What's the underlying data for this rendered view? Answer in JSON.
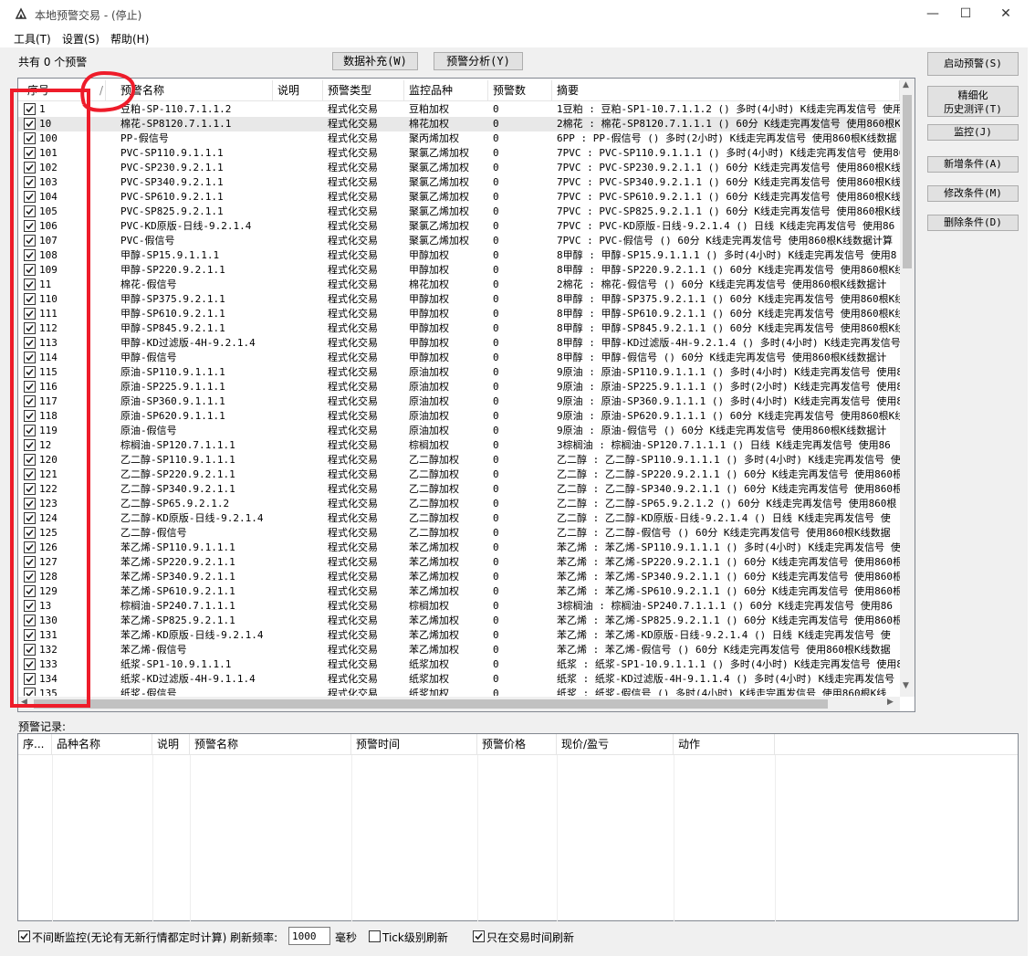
{
  "window": {
    "title": "本地预警交易 - (停止)",
    "minimize": "—",
    "maximize": "☐",
    "close": "✕"
  },
  "menu": [
    {
      "label": "工具(T)"
    },
    {
      "label": "设置(S)"
    },
    {
      "label": "帮助(H)"
    }
  ],
  "summary": {
    "count_label": "共有 0 个预警"
  },
  "toolbar": {
    "data_fill_label": "数据补充(W)",
    "analysis_label": "预警分析(Y)"
  },
  "side_buttons": {
    "start_label": "启动预警(S)",
    "refine_line1": "精细化",
    "refine_line2": "历史测评(T)",
    "monitor_label": "监控(J)",
    "add_label": "新增条件(A)",
    "edit_label": "修改条件(M)",
    "delete_label": "删除条件(D)"
  },
  "grid": {
    "columns": [
      "序号",
      "/",
      "预警名称",
      "说明",
      "预警类型",
      "监控品种",
      "预警数",
      "摘要"
    ],
    "rows": [
      {
        "id": "1",
        "name": "豆粕-SP-110.7.1.1.2",
        "note": "",
        "type": "程式化交易",
        "variety": "豆粕加权",
        "count": "0",
        "summary": "1豆粕 : 豆粕-SP1-10.7.1.1.2 () 多时(4小时) K线走完再发信号 使用",
        "checked": true
      },
      {
        "id": "10",
        "name": "棉花-SP8120.7.1.1.1",
        "note": "",
        "type": "程式化交易",
        "variety": "棉花加权",
        "count": "0",
        "summary": "2棉花 : 棉花-SP8120.7.1.1.1 () 60分 K线走完再发信号 使用860根K线",
        "checked": true
      },
      {
        "id": "100",
        "name": "PP-假信号",
        "note": "",
        "type": "程式化交易",
        "variety": "聚丙烯加权",
        "count": "0",
        "summary": "6PP : PP-假信号 () 多时(2小时) K线走完再发信号 使用860根K线数据",
        "checked": true
      },
      {
        "id": "101",
        "name": "PVC-SP110.9.1.1.1",
        "note": "",
        "type": "程式化交易",
        "variety": "聚氯乙烯加权",
        "count": "0",
        "summary": "7PVC : PVC-SP110.9.1.1.1 () 多时(4小时) K线走完再发信号 使用86",
        "checked": true
      },
      {
        "id": "102",
        "name": "PVC-SP230.9.2.1.1",
        "note": "",
        "type": "程式化交易",
        "variety": "聚氯乙烯加权",
        "count": "0",
        "summary": "7PVC : PVC-SP230.9.2.1.1 () 60分 K线走完再发信号 使用860根K线数",
        "checked": true
      },
      {
        "id": "103",
        "name": "PVC-SP340.9.2.1.1",
        "note": "",
        "type": "程式化交易",
        "variety": "聚氯乙烯加权",
        "count": "0",
        "summary": "7PVC : PVC-SP340.9.2.1.1 () 60分 K线走完再发信号 使用860根K线数",
        "checked": true
      },
      {
        "id": "104",
        "name": "PVC-SP610.9.2.1.1",
        "note": "",
        "type": "程式化交易",
        "variety": "聚氯乙烯加权",
        "count": "0",
        "summary": "7PVC : PVC-SP610.9.2.1.1 () 60分 K线走完再发信号 使用860根K线数",
        "checked": true
      },
      {
        "id": "105",
        "name": "PVC-SP825.9.2.1.1",
        "note": "",
        "type": "程式化交易",
        "variety": "聚氯乙烯加权",
        "count": "0",
        "summary": "7PVC : PVC-SP825.9.2.1.1 () 60分 K线走完再发信号 使用860根K线数",
        "checked": true
      },
      {
        "id": "106",
        "name": "PVC-KD原版-日线-9.2.1.4",
        "note": "",
        "type": "程式化交易",
        "variety": "聚氯乙烯加权",
        "count": "0",
        "summary": "7PVC : PVC-KD原版-日线-9.2.1.4 () 日线 K线走完再发信号 使用86",
        "checked": true
      },
      {
        "id": "107",
        "name": "PVC-假信号",
        "note": "",
        "type": "程式化交易",
        "variety": "聚氯乙烯加权",
        "count": "0",
        "summary": "7PVC : PVC-假信号 () 60分 K线走完再发信号 使用860根K线数据计算",
        "checked": true
      },
      {
        "id": "108",
        "name": "甲醇-SP15.9.1.1.1",
        "note": "",
        "type": "程式化交易",
        "variety": "甲醇加权",
        "count": "0",
        "summary": "8甲醇 : 甲醇-SP15.9.1.1.1 () 多时(4小时) K线走完再发信号 使用8",
        "checked": true
      },
      {
        "id": "109",
        "name": "甲醇-SP220.9.2.1.1",
        "note": "",
        "type": "程式化交易",
        "variety": "甲醇加权",
        "count": "0",
        "summary": "8甲醇 : 甲醇-SP220.9.2.1.1 () 60分 K线走完再发信号 使用860根K线",
        "checked": true
      },
      {
        "id": "11",
        "name": "棉花-假信号",
        "note": "",
        "type": "程式化交易",
        "variety": "棉花加权",
        "count": "0",
        "summary": "2棉花 : 棉花-假信号 () 60分 K线走完再发信号 使用860根K线数据计",
        "checked": true
      },
      {
        "id": "110",
        "name": "甲醇-SP375.9.2.1.1",
        "note": "",
        "type": "程式化交易",
        "variety": "甲醇加权",
        "count": "0",
        "summary": "8甲醇 : 甲醇-SP375.9.2.1.1 () 60分 K线走完再发信号 使用860根K线",
        "checked": true
      },
      {
        "id": "111",
        "name": "甲醇-SP610.9.2.1.1",
        "note": "",
        "type": "程式化交易",
        "variety": "甲醇加权",
        "count": "0",
        "summary": "8甲醇 : 甲醇-SP610.9.2.1.1 () 60分 K线走完再发信号 使用860根K线",
        "checked": true
      },
      {
        "id": "112",
        "name": "甲醇-SP845.9.2.1.1",
        "note": "",
        "type": "程式化交易",
        "variety": "甲醇加权",
        "count": "0",
        "summary": "8甲醇 : 甲醇-SP845.9.2.1.1 () 60分 K线走完再发信号 使用860根K线",
        "checked": true
      },
      {
        "id": "113",
        "name": "甲醇-KD过滤版-4H-9.2.1.4",
        "note": "",
        "type": "程式化交易",
        "variety": "甲醇加权",
        "count": "0",
        "summary": "8甲醇 : 甲醇-KD过滤版-4H-9.2.1.4 () 多时(4小时) K线走完再发信号",
        "checked": true
      },
      {
        "id": "114",
        "name": "甲醇-假信号",
        "note": "",
        "type": "程式化交易",
        "variety": "甲醇加权",
        "count": "0",
        "summary": "8甲醇 : 甲醇-假信号 () 60分 K线走完再发信号 使用860根K线数据计",
        "checked": true
      },
      {
        "id": "115",
        "name": "原油-SP110.9.1.1.1",
        "note": "",
        "type": "程式化交易",
        "variety": "原油加权",
        "count": "0",
        "summary": "9原油 : 原油-SP110.9.1.1.1 () 多时(4小时) K线走完再发信号 使用8",
        "checked": true
      },
      {
        "id": "116",
        "name": "原油-SP225.9.1.1.1",
        "note": "",
        "type": "程式化交易",
        "variety": "原油加权",
        "count": "0",
        "summary": "9原油 : 原油-SP225.9.1.1.1 () 多时(2小时) K线走完再发信号 使用8",
        "checked": true
      },
      {
        "id": "117",
        "name": "原油-SP360.9.1.1.1",
        "note": "",
        "type": "程式化交易",
        "variety": "原油加权",
        "count": "0",
        "summary": "9原油 : 原油-SP360.9.1.1.1 () 多时(4小时) K线走完再发信号 使用8",
        "checked": true
      },
      {
        "id": "118",
        "name": "原油-SP620.9.1.1.1",
        "note": "",
        "type": "程式化交易",
        "variety": "原油加权",
        "count": "0",
        "summary": "9原油 : 原油-SP620.9.1.1.1 () 60分 K线走完再发信号 使用860根K线",
        "checked": true
      },
      {
        "id": "119",
        "name": "原油-假信号",
        "note": "",
        "type": "程式化交易",
        "variety": "原油加权",
        "count": "0",
        "summary": "9原油 : 原油-假信号 () 60分 K线走完再发信号 使用860根K线数据计",
        "checked": true
      },
      {
        "id": "12",
        "name": "棕榈油-SP120.7.1.1.1",
        "note": "",
        "type": "程式化交易",
        "variety": "棕榈加权",
        "count": "0",
        "summary": "3棕榈油 : 棕榈油-SP120.7.1.1.1 () 日线 K线走完再发信号 使用86",
        "checked": true
      },
      {
        "id": "120",
        "name": "乙二醇-SP110.9.1.1.1",
        "note": "",
        "type": "程式化交易",
        "variety": "乙二醇加权",
        "count": "0",
        "summary": "乙二醇 : 乙二醇-SP110.9.1.1.1 () 多时(4小时) K线走完再发信号 使",
        "checked": true
      },
      {
        "id": "121",
        "name": "乙二醇-SP220.9.2.1.1",
        "note": "",
        "type": "程式化交易",
        "variety": "乙二醇加权",
        "count": "0",
        "summary": "乙二醇 : 乙二醇-SP220.9.2.1.1 () 60分 K线走完再发信号 使用860根",
        "checked": true
      },
      {
        "id": "122",
        "name": "乙二醇-SP340.9.2.1.1",
        "note": "",
        "type": "程式化交易",
        "variety": "乙二醇加权",
        "count": "0",
        "summary": "乙二醇 : 乙二醇-SP340.9.2.1.1 () 60分 K线走完再发信号 使用860根",
        "checked": true
      },
      {
        "id": "123",
        "name": "乙二醇-SP65.9.2.1.2",
        "note": "",
        "type": "程式化交易",
        "variety": "乙二醇加权",
        "count": "0",
        "summary": "乙二醇 : 乙二醇-SP65.9.2.1.2 () 60分 K线走完再发信号 使用860根",
        "checked": true
      },
      {
        "id": "124",
        "name": "乙二醇-KD原版-日线-9.2.1.4",
        "note": "",
        "type": "程式化交易",
        "variety": "乙二醇加权",
        "count": "0",
        "summary": "乙二醇 : 乙二醇-KD原版-日线-9.2.1.4 () 日线 K线走完再发信号 使",
        "checked": true
      },
      {
        "id": "125",
        "name": "乙二醇-假信号",
        "note": "",
        "type": "程式化交易",
        "variety": "乙二醇加权",
        "count": "0",
        "summary": "乙二醇 : 乙二醇-假信号 () 60分 K线走完再发信号 使用860根K线数据",
        "checked": true
      },
      {
        "id": "126",
        "name": "苯乙烯-SP110.9.1.1.1",
        "note": "",
        "type": "程式化交易",
        "variety": "苯乙烯加权",
        "count": "0",
        "summary": "苯乙烯 : 苯乙烯-SP110.9.1.1.1 () 多时(4小时) K线走完再发信号 使",
        "checked": true
      },
      {
        "id": "127",
        "name": "苯乙烯-SP220.9.2.1.1",
        "note": "",
        "type": "程式化交易",
        "variety": "苯乙烯加权",
        "count": "0",
        "summary": "苯乙烯 : 苯乙烯-SP220.9.2.1.1 () 60分 K线走完再发信号 使用860根",
        "checked": true
      },
      {
        "id": "128",
        "name": "苯乙烯-SP340.9.2.1.1",
        "note": "",
        "type": "程式化交易",
        "variety": "苯乙烯加权",
        "count": "0",
        "summary": "苯乙烯 : 苯乙烯-SP340.9.2.1.1 () 60分 K线走完再发信号 使用860根",
        "checked": true
      },
      {
        "id": "129",
        "name": "苯乙烯-SP610.9.2.1.1",
        "note": "",
        "type": "程式化交易",
        "variety": "苯乙烯加权",
        "count": "0",
        "summary": "苯乙烯 : 苯乙烯-SP610.9.2.1.1 () 60分 K线走完再发信号 使用860根",
        "checked": true
      },
      {
        "id": "13",
        "name": "棕榈油-SP240.7.1.1.1",
        "note": "",
        "type": "程式化交易",
        "variety": "棕榈加权",
        "count": "0",
        "summary": "3棕榈油 : 棕榈油-SP240.7.1.1.1 () 60分 K线走完再发信号 使用86",
        "checked": true
      },
      {
        "id": "130",
        "name": "苯乙烯-SP825.9.2.1.1",
        "note": "",
        "type": "程式化交易",
        "variety": "苯乙烯加权",
        "count": "0",
        "summary": "苯乙烯 : 苯乙烯-SP825.9.2.1.1 () 60分 K线走完再发信号 使用860根",
        "checked": true
      },
      {
        "id": "131",
        "name": "苯乙烯-KD原版-日线-9.2.1.4",
        "note": "",
        "type": "程式化交易",
        "variety": "苯乙烯加权",
        "count": "0",
        "summary": "苯乙烯 : 苯乙烯-KD原版-日线-9.2.1.4 () 日线 K线走完再发信号 使",
        "checked": true
      },
      {
        "id": "132",
        "name": "苯乙烯-假信号",
        "note": "",
        "type": "程式化交易",
        "variety": "苯乙烯加权",
        "count": "0",
        "summary": "苯乙烯 : 苯乙烯-假信号 () 60分 K线走完再发信号 使用860根K线数据",
        "checked": true
      },
      {
        "id": "133",
        "name": "纸浆-SP1-10.9.1.1.1",
        "note": "",
        "type": "程式化交易",
        "variety": "纸浆加权",
        "count": "0",
        "summary": "纸浆 : 纸浆-SP1-10.9.1.1.1 () 多时(4小时) K线走完再发信号 使用8",
        "checked": true
      },
      {
        "id": "134",
        "name": "纸浆-KD过滤版-4H-9.1.1.4",
        "note": "",
        "type": "程式化交易",
        "variety": "纸浆加权",
        "count": "0",
        "summary": "纸浆 : 纸浆-KD过滤版-4H-9.1.1.4 () 多时(4小时) K线走完再发信号",
        "checked": true
      },
      {
        "id": "135",
        "name": "纸浆-假信号",
        "note": "",
        "type": "程式化交易",
        "variety": "纸浆加权",
        "count": "0",
        "summary": "纸浆 : 纸浆-假信号 () 多时(4小时) K线走完再发信号 使用860根K线",
        "checked": true
      }
    ]
  },
  "log": {
    "label": "预警记录:",
    "columns": [
      "序...",
      "品种名称",
      "说明",
      "预警名称",
      "预警时间",
      "预警价格",
      "现价/盈亏",
      "动作"
    ]
  },
  "bottom": {
    "continuous_label": "不间断监控(无论有无新行情都定时计算) 刷新频率:",
    "continuous_checked": true,
    "freq_value": "1000",
    "ms_label": "毫秒",
    "tick_label": "Tick级别刷新",
    "tick_checked": false,
    "trade_time_label": "只在交易时间刷新",
    "trade_time_checked": true
  }
}
